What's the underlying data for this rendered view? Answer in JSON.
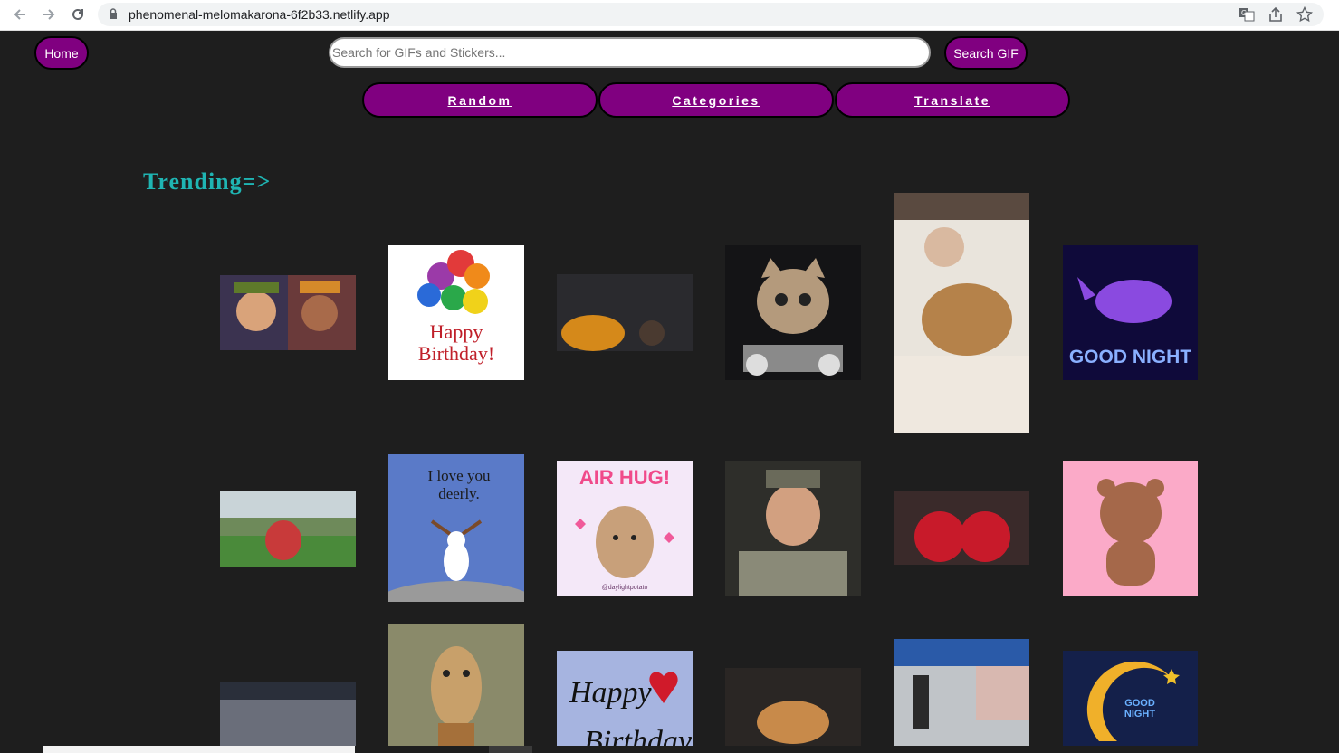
{
  "browser": {
    "url": "phenomenal-melomakarona-6f2b33.netlify.app"
  },
  "header": {
    "home_label": "Home",
    "search_placeholder": "Search for GIFs and Stickers...",
    "search_button": "Search GIF"
  },
  "tabs": [
    "Random",
    "Categories",
    "Translate"
  ],
  "section_title": "Trending=>",
  "gif_text": {
    "birthday": "Happy Birthday!",
    "goodnight": "GOOD NIGHT",
    "iloveyou": "I love you deerly.",
    "airhug": "AIR HUG!",
    "airhug_credit": "@daylightpotato",
    "happy": "Happy",
    "birthday2": "Birthday",
    "goodnight2": "GOOD NIGHT"
  },
  "colors": {
    "background": "#1e1e1e",
    "accent_purple": "#800080",
    "trending_teal": "#1fb5b3"
  }
}
